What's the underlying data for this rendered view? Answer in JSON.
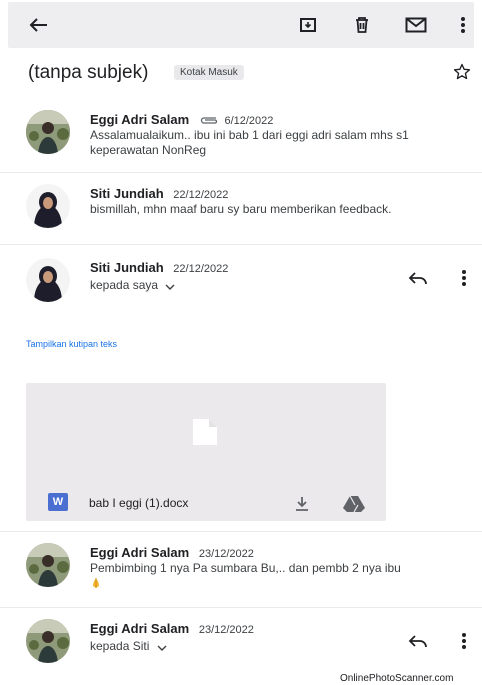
{
  "toolbar": {
    "icons": [
      "back-arrow-icon",
      "archive-icon",
      "delete-icon",
      "mark-unread-icon",
      "more-vert-icon"
    ]
  },
  "thread": {
    "subject": "(tanpa subjek)",
    "label": "Kotak Masuk"
  },
  "messages": [
    {
      "sender": "Eggi Adri Salam",
      "date": "6/12/2022",
      "has_attachment_icon": true,
      "snippet": "Assalamualaikum.. ibu ini bab 1 dari eggi adri salam mhs s1 keperawatan NonReg"
    },
    {
      "sender": "Siti Jundiah",
      "date": "22/12/2022",
      "snippet": "bismillah, mhn maaf baru sy baru memberikan feedback."
    },
    {
      "sender": "Siti Jundiah",
      "date": "22/12/2022",
      "recipient_line": "kepada saya",
      "expanded": true
    },
    {
      "sender": "Eggi Adri Salam",
      "date": "23/12/2022",
      "snippet": "Pembimbing 1 nya Pa sumbara Bu,.. dan pembb 2 nya ibu"
    },
    {
      "sender": "Eggi Adri Salam",
      "date": "23/12/2022",
      "recipient_line": "kepada Siti"
    }
  ],
  "expanded": {
    "show_quoted": "Tampilkan kutipan teks",
    "attachment": {
      "filename": "bab I eggi (1).docx",
      "type_badge": "W"
    }
  },
  "watermark": "OnlinePhotoScanner.com",
  "colors": {
    "topbar": "#eeeef0",
    "link": "#1a73e8",
    "attachment_bg": "#ebe9eb",
    "word_badge": "#4a6fd1"
  }
}
